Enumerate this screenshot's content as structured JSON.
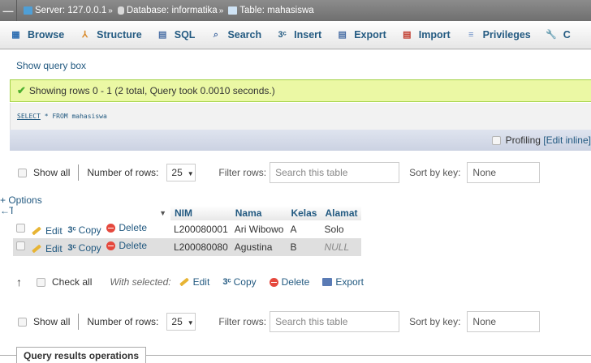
{
  "breadcrumb": {
    "collapse_label": "—",
    "server_label": "Server:",
    "server_value": "127.0.0.1",
    "database_label": "Database:",
    "database_value": "informatika",
    "table_label": "Table:",
    "table_value": "mahasiswa",
    "arrow": "»"
  },
  "tabs": [
    {
      "label": "Browse",
      "icon": "browse-icon",
      "glyph": "▦",
      "color": "#2b6cb0"
    },
    {
      "label": "Structure",
      "icon": "structure-icon",
      "glyph": "⅄",
      "color": "#d98a2b"
    },
    {
      "label": "SQL",
      "icon": "sql-icon",
      "glyph": "▤",
      "color": "#4a6fa5"
    },
    {
      "label": "Search",
      "icon": "search-icon",
      "glyph": "⌕",
      "color": "#4a6fa5"
    },
    {
      "label": "Insert",
      "icon": "insert-icon",
      "glyph": "3ᶜ",
      "color": "#235a81"
    },
    {
      "label": "Export",
      "icon": "export-icon",
      "glyph": "▤",
      "color": "#4a6fa5"
    },
    {
      "label": "Import",
      "icon": "import-icon",
      "glyph": "▤",
      "color": "#c0392b"
    },
    {
      "label": "Privileges",
      "icon": "privileges-icon",
      "glyph": "≡",
      "color": "#6b8fc7"
    },
    {
      "label": "C",
      "icon": "operations-icon",
      "glyph": "🔧",
      "color": "#777777"
    }
  ],
  "show_query_box": "Show query box",
  "success_message": "Showing rows 0 - 1 (2 total, Query took 0.0010 seconds.)",
  "sql_query": {
    "select": "SELECT",
    "rest": " * FROM mahasiswa"
  },
  "profiling": {
    "label": "Profiling",
    "link_open": "[",
    "link": "Edit inline",
    "link_close": "]"
  },
  "nav": {
    "show_all": "Show all",
    "rows_label": "Number of rows:",
    "rows_value": "25",
    "filter_label": "Filter rows:",
    "filter_placeholder": "Search this table",
    "sort_label": "Sort by key:",
    "sort_value": "None"
  },
  "options_link": "+ Options",
  "column_arrows": "←T→",
  "sort_glyph": "▼",
  "columns": [
    "NIM",
    "Nama",
    "Kelas",
    "Alamat"
  ],
  "actions": {
    "edit": "Edit",
    "copy": "Copy",
    "delete": "Delete"
  },
  "rows": [
    {
      "nim": "L200080001",
      "nama": "Ari Wibowo",
      "kelas": "A",
      "alamat": "Solo"
    },
    {
      "nim": "L200080080",
      "nama": "Agustina",
      "kelas": "B",
      "alamat": "NULL"
    }
  ],
  "bulk": {
    "check_all": "Check all",
    "with_selected": "With selected:",
    "edit": "Edit",
    "copy": "Copy",
    "delete": "Delete",
    "export": "Export"
  },
  "query_results_operations": "Query results operations"
}
